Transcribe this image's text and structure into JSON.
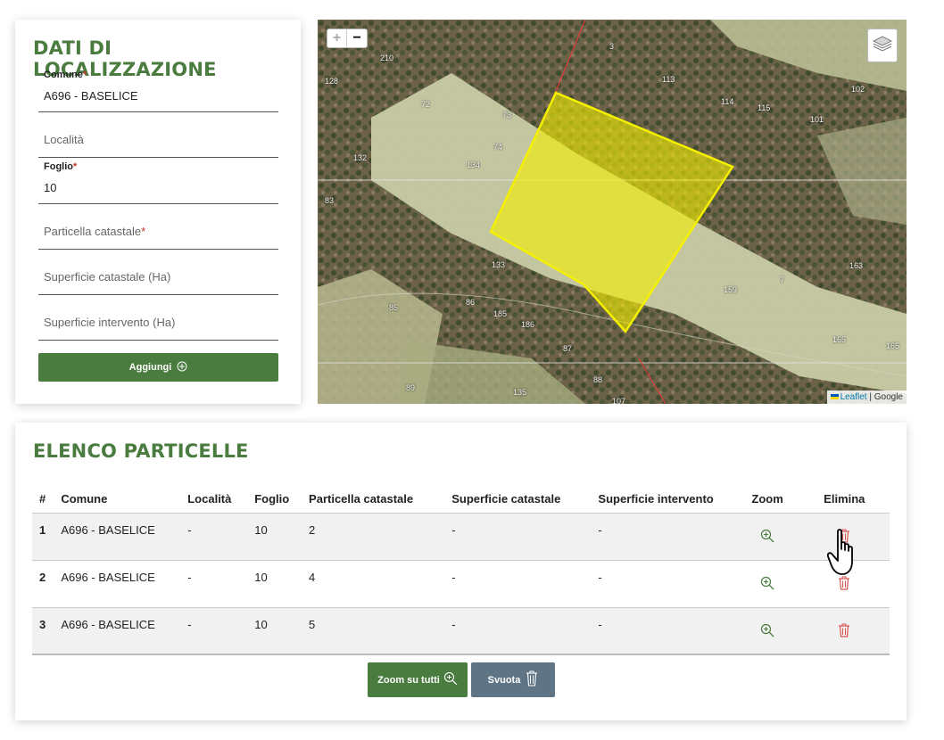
{
  "form": {
    "title": "DATI DI LOCALIZZAZIONE",
    "comune": {
      "label": "Comune",
      "required_mark": "*",
      "value": "A696 - BASELICE"
    },
    "localita": {
      "placeholder": "Località"
    },
    "foglio": {
      "label": "Foglio",
      "required_mark": "*",
      "value": "10"
    },
    "particella": {
      "placeholder": "Particella catastale",
      "required_mark": "*"
    },
    "superficie_catastale": {
      "placeholder": "Superficie catastale (Ha)"
    },
    "superficie_intervento": {
      "placeholder": "Superficie intervento (Ha)"
    },
    "add_button": "Aggiungi"
  },
  "map": {
    "zoom_in": "+",
    "zoom_out": "−",
    "attribution_link": "Leaflet",
    "attribution_sep": " | ",
    "attribution_provider": "Google",
    "parcel_labels": [
      "210",
      "3",
      "128",
      "113",
      "102",
      "72",
      "73",
      "114",
      "115",
      "101",
      "74",
      "132",
      "134",
      "83",
      "133",
      "159",
      "7",
      "163",
      "85",
      "86",
      "185",
      "186",
      "87",
      "165",
      "165",
      "89",
      "88",
      "135",
      "107"
    ]
  },
  "list": {
    "title": "ELENCO PARTICELLE",
    "columns": [
      "#",
      "Comune",
      "Località",
      "Foglio",
      "Particella catastale",
      "Superficie catastale",
      "Superficie intervento",
      "Zoom",
      "Elimina"
    ],
    "rows": [
      {
        "idx": "1",
        "comune": "A696 - BASELICE",
        "localita": "-",
        "foglio": "10",
        "particella": "2",
        "sup_cat": "-",
        "sup_int": "-"
      },
      {
        "idx": "2",
        "comune": "A696 - BASELICE",
        "localita": "-",
        "foglio": "10",
        "particella": "4",
        "sup_cat": "-",
        "sup_int": "-"
      },
      {
        "idx": "3",
        "comune": "A696 - BASELICE",
        "localita": "-",
        "foglio": "10",
        "particella": "5",
        "sup_cat": "-",
        "sup_int": "-"
      }
    ],
    "zoom_all_button": "Zoom su tutti",
    "clear_button": "Svuota"
  },
  "colors": {
    "accent_green": "#4a7c3f",
    "slate": "#5f7585",
    "delete_red": "#d9534f",
    "parcel_yellow": "#f5f000"
  }
}
